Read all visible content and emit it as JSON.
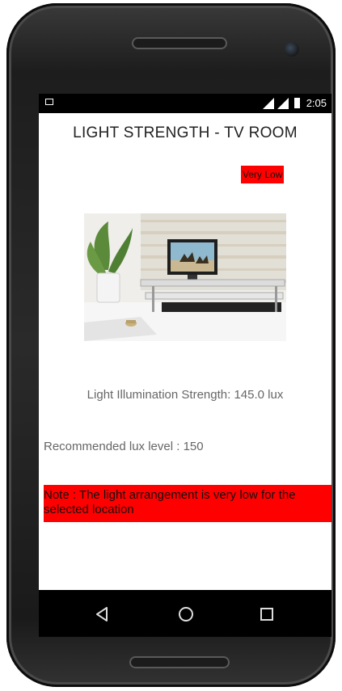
{
  "status_bar": {
    "time": "2:05",
    "icons": [
      "image-notification-icon",
      "signal-icon",
      "signal-icon",
      "battery-icon"
    ]
  },
  "page": {
    "title": "LIGHT STRENGTH - TV ROOM",
    "level_badge": "Very Low",
    "illumination_text": "Light Illumination Strength: 145.0 lux",
    "recommended_text": "Recommended lux level : 150",
    "note_text": "Note : The light arrangement is very low for the selected location"
  },
  "colors": {
    "alert_red": "#ff0000",
    "status_bar": "#000000",
    "text_gray": "#666666"
  },
  "nav_bar": {
    "buttons": [
      "back-icon",
      "home-icon",
      "recents-icon"
    ]
  }
}
